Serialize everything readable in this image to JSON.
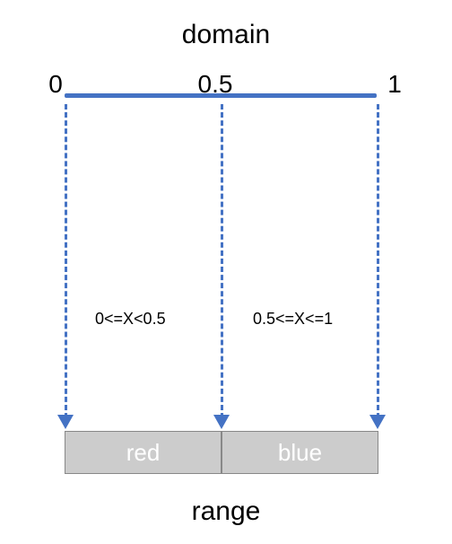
{
  "labels": {
    "domain_title": "domain",
    "range_title": "range",
    "tick0": "0",
    "tick05": "0.5",
    "tick1": "1",
    "interval_left": "0<=X<0.5",
    "interval_right": "0.5<=X<=1",
    "range_left": "red",
    "range_right": "blue"
  },
  "chart_data": {
    "type": "table",
    "title": "domain → range mapping",
    "domain": {
      "min": 0,
      "max": 1,
      "breakpoints": [
        0,
        0.5,
        1
      ]
    },
    "mapping": [
      {
        "condition": "0<=X<0.5",
        "value": "red"
      },
      {
        "condition": "0.5<=X<=1",
        "value": "blue"
      }
    ]
  }
}
